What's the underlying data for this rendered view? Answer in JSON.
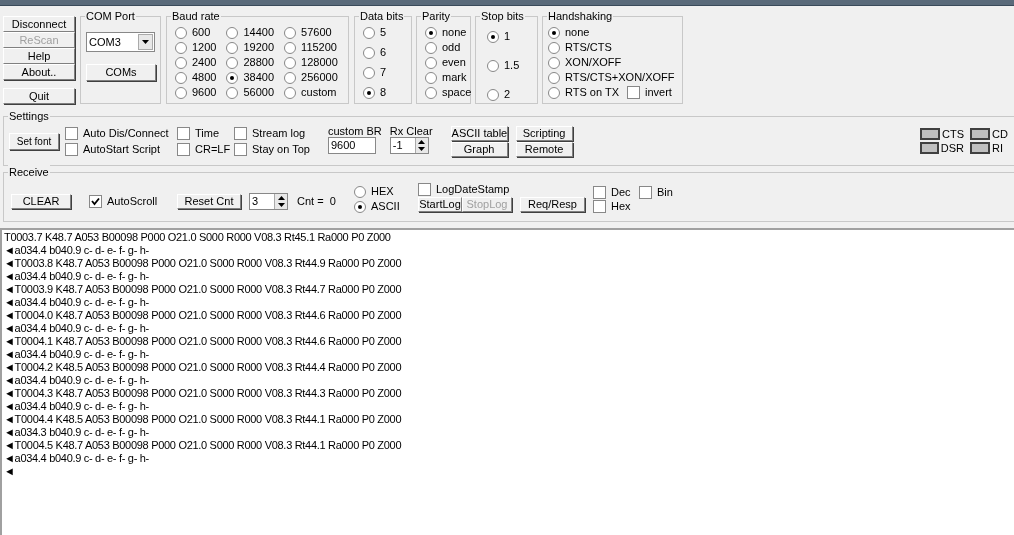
{
  "buttons": [
    {
      "label": "Disconnect",
      "disabled": false
    },
    {
      "label": "ReScan",
      "disabled": true
    },
    {
      "label": "Help",
      "disabled": false
    },
    {
      "label": "About..",
      "disabled": false
    },
    {
      "label": "Quit",
      "disabled": false
    }
  ],
  "com_port": {
    "title": "COM Port",
    "value": "COM3",
    "button": "COMs"
  },
  "baud_rate": {
    "title": "Baud rate",
    "options": [
      {
        "label": "600",
        "selected": false
      },
      {
        "label": "1200",
        "selected": false
      },
      {
        "label": "2400",
        "selected": false
      },
      {
        "label": "4800",
        "selected": false
      },
      {
        "label": "9600",
        "selected": false
      },
      {
        "label": "14400",
        "selected": false
      },
      {
        "label": "19200",
        "selected": false
      },
      {
        "label": "28800",
        "selected": false
      },
      {
        "label": "38400",
        "selected": true
      },
      {
        "label": "56000",
        "selected": false
      },
      {
        "label": "57600",
        "selected": false
      },
      {
        "label": "115200",
        "selected": false
      },
      {
        "label": "128000",
        "selected": false
      },
      {
        "label": "256000",
        "selected": false
      },
      {
        "label": "custom",
        "selected": false
      }
    ]
  },
  "data_bits": {
    "title": "Data bits",
    "options": [
      {
        "label": "5",
        "selected": false
      },
      {
        "label": "6",
        "selected": false
      },
      {
        "label": "7",
        "selected": false
      },
      {
        "label": "8",
        "selected": true
      }
    ]
  },
  "parity": {
    "title": "Parity",
    "options": [
      {
        "label": "none",
        "selected": true
      },
      {
        "label": "odd",
        "selected": false
      },
      {
        "label": "even",
        "selected": false
      },
      {
        "label": "mark",
        "selected": false
      },
      {
        "label": "space",
        "selected": false
      }
    ]
  },
  "stop_bits": {
    "title": "Stop bits",
    "options": [
      {
        "label": "1",
        "selected": true
      },
      {
        "label": "1.5",
        "selected": false
      },
      {
        "label": "2",
        "selected": false
      }
    ]
  },
  "handshaking": {
    "title": "Handshaking",
    "options": [
      {
        "label": "none",
        "selected": true
      },
      {
        "label": "RTS/CTS",
        "selected": false
      },
      {
        "label": "XON/XOFF",
        "selected": false
      },
      {
        "label": "RTS/CTS+XON/XOFF",
        "selected": false
      },
      {
        "label": "RTS on TX",
        "selected": false
      }
    ],
    "invert": {
      "label": "invert",
      "checked": false
    }
  },
  "settings": {
    "title": "Settings",
    "set_font": "Set font",
    "checks": [
      {
        "label": "Auto Dis/Connect",
        "checked": false
      },
      {
        "label": "AutoStart Script",
        "checked": false
      },
      {
        "label": "Time",
        "checked": false
      },
      {
        "label": "CR=LF",
        "checked": false
      },
      {
        "label": "Stream log",
        "checked": false
      },
      {
        "label": "Stay on Top",
        "checked": false
      }
    ],
    "custom_br": {
      "label": "custom BR",
      "value": "9600"
    },
    "rx_clear": {
      "label": "Rx Clear",
      "value": "-1"
    },
    "tools": [
      "ASCII table",
      "Scripting",
      "Graph",
      "Remote"
    ],
    "signals": [
      {
        "label": "CTS",
        "on": false
      },
      {
        "label": "CD",
        "on": false
      },
      {
        "label": "DSR",
        "on": false
      },
      {
        "label": "RI",
        "on": false
      }
    ]
  },
  "receive": {
    "title": "Receive",
    "clear": "CLEAR",
    "autoscroll": {
      "label": "AutoScroll",
      "checked": true
    },
    "reset_cnt": "Reset Cnt",
    "cnt_value": "3",
    "cnt_text": "Cnt =  0",
    "modes": [
      {
        "label": "HEX",
        "selected": false
      },
      {
        "label": "ASCII",
        "selected": true
      }
    ],
    "log_date_stamp": {
      "label": "LogDateStamp",
      "checked": false
    },
    "start_log": {
      "label": "StartLog",
      "disabled": false
    },
    "stop_log": {
      "label": "StopLog",
      "disabled": true
    },
    "req_resp": "Req/Resp",
    "formats": [
      {
        "label": "Dec",
        "checked": false
      },
      {
        "label": "Bin",
        "checked": false
      },
      {
        "label": "Hex",
        "checked": false
      }
    ]
  },
  "terminal": {
    "lines": [
      "T0003.7 K48.7 A053 B00098 P000 O21.0 S000 R000 V08.3 Rt45.1 Ra000 P0 Z000",
      "◄a034.4 b040.9 c- d- e- f- g- h-",
      "◄T0003.8 K48.7 A053 B00098 P000 O21.0 S000 R000 V08.3 Rt44.9 Ra000 P0 Z000",
      "◄a034.4 b040.9 c- d- e- f- g- h-",
      "◄T0003.9 K48.7 A053 B00098 P000 O21.0 S000 R000 V08.3 Rt44.7 Ra000 P0 Z000",
      "◄a034.4 b040.9 c- d- e- f- g- h-",
      "◄T0004.0 K48.7 A053 B00098 P000 O21.0 S000 R000 V08.3 Rt44.6 Ra000 P0 Z000",
      "◄a034.4 b040.9 c- d- e- f- g- h-",
      "◄T0004.1 K48.7 A053 B00098 P000 O21.0 S000 R000 V08.3 Rt44.6 Ra000 P0 Z000",
      "◄a034.4 b040.9 c- d- e- f- g- h-",
      "◄T0004.2 K48.5 A053 B00098 P000 O21.0 S000 R000 V08.3 Rt44.4 Ra000 P0 Z000",
      "◄a034.4 b040.9 c- d- e- f- g- h-",
      "◄T0004.3 K48.7 A053 B00098 P000 O21.0 S000 R000 V08.3 Rt44.3 Ra000 P0 Z000",
      "◄a034.4 b040.9 c- d- e- f- g- h-",
      "◄T0004.4 K48.5 A053 B00098 P000 O21.0 S000 R000 V08.3 Rt44.1 Ra000 P0 Z000",
      "◄a034.3 b040.9 c- d- e- f- g- h-",
      "◄T0004.5 K48.7 A053 B00098 P000 O21.0 S000 R000 V08.3 Rt44.1 Ra000 P0 Z000",
      "◄a034.4 b040.9 c- d- e- f- g- h-",
      "◄"
    ]
  }
}
